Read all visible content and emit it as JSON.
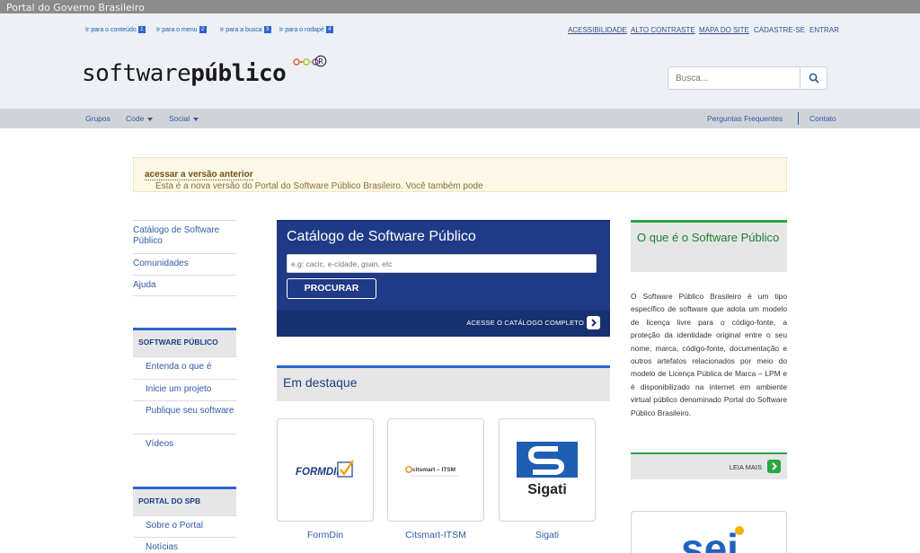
{
  "gov_bar": {
    "title": "Portal do Governo Brasileiro"
  },
  "skip_links": [
    {
      "label": "Ir para o conteúdo",
      "key": "1"
    },
    {
      "label": "Ir para o menu",
      "key": "2"
    },
    {
      "label": "Ir para a busca",
      "key": "3"
    },
    {
      "label": "Ir para o rodapé",
      "key": "4"
    }
  ],
  "top_links": {
    "accessibility": "ACESSIBILIDADE",
    "high_contrast": "ALTO CONTRASTE",
    "site_map": "MAPA DO SITE",
    "register": "CADASTRE-SE",
    "login": "ENTRAR"
  },
  "logo": {
    "part1": "software",
    "part2": "público",
    "mark": "®"
  },
  "search": {
    "placeholder": "Busca..."
  },
  "nav": {
    "groups": "Grupos",
    "code": "Code",
    "social": "Social",
    "faq": "Perguntas Frequentes",
    "contact": "Contato"
  },
  "notice": {
    "text": "Esta é a nova versão do Portal do Software Público Brasileiro. Você também pode ",
    "link": "acessar a versão anterior",
    "end": "."
  },
  "left_nav": [
    "Catálogo de Software Público",
    "Comunidades",
    "Ajuda"
  ],
  "software_publico_box": {
    "title": "SOFTWARE PÚBLICO",
    "items": [
      "Entenda o que é",
      "Inicie um projeto",
      "Publique seu software",
      "Vídeos"
    ]
  },
  "portal_box": {
    "title": "PORTAL DO SPB",
    "items": [
      "Sobre o Portal",
      "Notícias"
    ]
  },
  "catalog": {
    "title": "Catálogo de Software Público",
    "placeholder": "e.g: cacic, e-cidade, gsan, etc",
    "button": "PROCURAR",
    "footer_link": "ACESSE O CATÁLOGO COMPLETO"
  },
  "featured": {
    "title": "Em destaque",
    "items": [
      {
        "name": "FormDin",
        "logo_text": "FORMDIN"
      },
      {
        "name": "Citsmart-ITSM",
        "logo_text": "citsmart – ITSM"
      },
      {
        "name": "Sigati",
        "logo_text": "Sigati"
      }
    ]
  },
  "about": {
    "title": "O que é o Software Público",
    "text": "O Software Público Brasileiro é um tipo específico de software que adota um modelo de licença livre para o código-fonte, a proteção da identidade original entre o seu nome, marca, código-fonte, documentação e outros artefatos relacionados por meio do modelo de Licença Pública de Marca – LPM e é disponibilizado na internet em ambiente virtual público denominado Portal do Software Público Brasileiro.",
    "read_more": "LEIA MAIS"
  },
  "sei_logo": "sei",
  "colors": {
    "primary_blue": "#1f3a86",
    "accent_blue": "#2c66ce",
    "green": "#28a745",
    "notice_bg": "#fcf8e5"
  }
}
